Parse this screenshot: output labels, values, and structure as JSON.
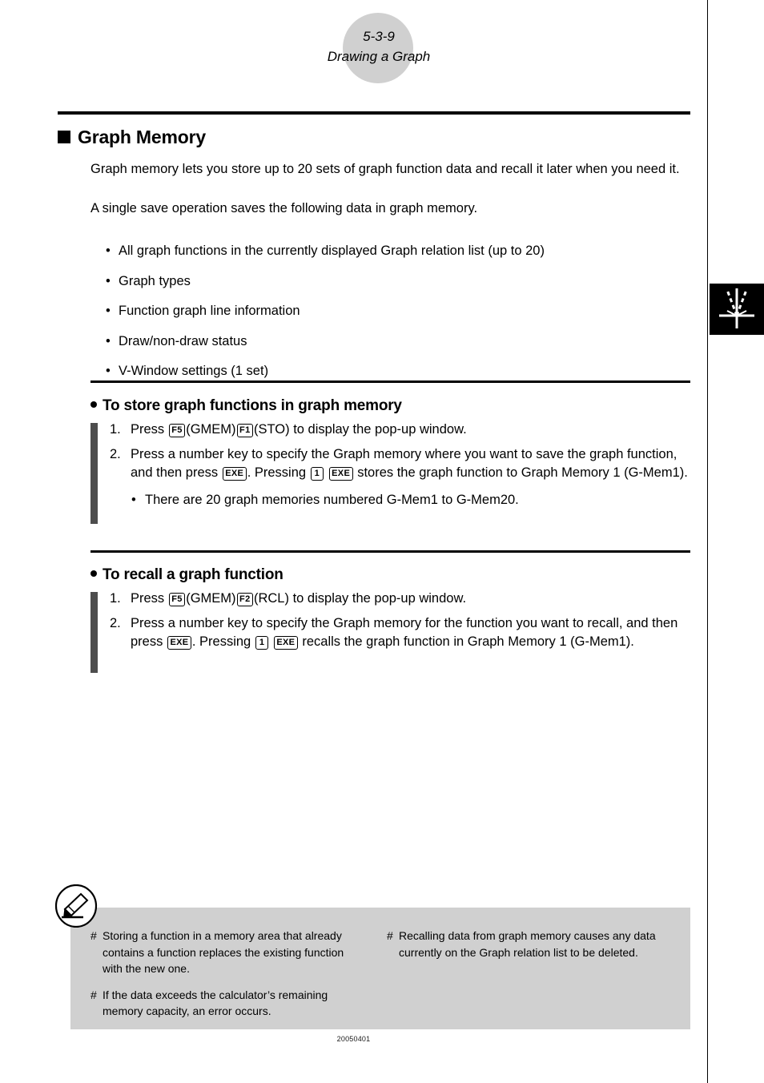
{
  "header": {
    "page_number": "5-3-9",
    "chapter_title": "Drawing a Graph"
  },
  "section": {
    "title": "Graph Memory",
    "intro_paragraph_1": "Graph memory lets you store up to 20 sets of graph function data and recall it later when you need it.",
    "intro_paragraph_2": "A single save operation saves the following data in graph memory.",
    "saved_items": [
      "All graph functions in the currently displayed Graph relation list (up to 20)",
      "Graph types",
      "Function graph line information",
      "Draw/non-draw status",
      "V-Window settings (1 set)"
    ]
  },
  "procedure_store": {
    "heading": "To store graph functions in graph memory",
    "step1": {
      "number": "1.",
      "text_a": "Press",
      "key1": "F5",
      "label1": "(GMEM)",
      "key2": "F1",
      "label2": "(STO)",
      "text_b": "to display the pop-up window."
    },
    "step2": {
      "number": "2.",
      "text_a": "Press a number key to specify the Graph memory where you want to save the graph function, and then press",
      "key1": "EXE",
      "text_b": ". Pressing",
      "key2": "1",
      "key3": "EXE",
      "text_c": "stores the graph function to Graph Memory 1 (G-Mem1)."
    },
    "subnote": "There are 20 graph memories numbered G-Mem1 to G-Mem20."
  },
  "procedure_recall": {
    "heading": "To recall a graph function",
    "step1": {
      "number": "1.",
      "text_a": "Press",
      "key1": "F5",
      "label1": "(GMEM)",
      "key2": "F2",
      "label2": "(RCL)",
      "text_b": "to display the pop-up window."
    },
    "step2": {
      "number": "2.",
      "text_a": "Press a number key to specify the Graph memory for the function you want to recall, and then press",
      "key1": "EXE",
      "text_b": ". Pressing",
      "key2": "1",
      "key3": "EXE",
      "text_c": "recalls the graph function in Graph Memory 1 (G-Mem1)."
    }
  },
  "footnotes": {
    "marker": "#",
    "left": [
      "Storing a function in a memory area that already contains a function replaces the existing function with the new one.",
      "If the data exceeds the calculator’s remaining memory capacity, an error occurs."
    ],
    "right": [
      "Recalling data from graph memory causes any data currently on the Graph relation list to be deleted."
    ]
  },
  "footer": {
    "document_code": "20050401"
  },
  "colors": {
    "header_circle": "#d0d0d0",
    "note_background": "#d0d0d0",
    "step_bar": "#4d4d4d",
    "tab_background": "#000000",
    "text": "#000000"
  },
  "icons": {
    "thumb_tab": "graph-axes-icon",
    "note": "pencil-icon",
    "section_bullet": "filled-square-bullet",
    "procedure_bullet": "filled-round-bullet"
  }
}
